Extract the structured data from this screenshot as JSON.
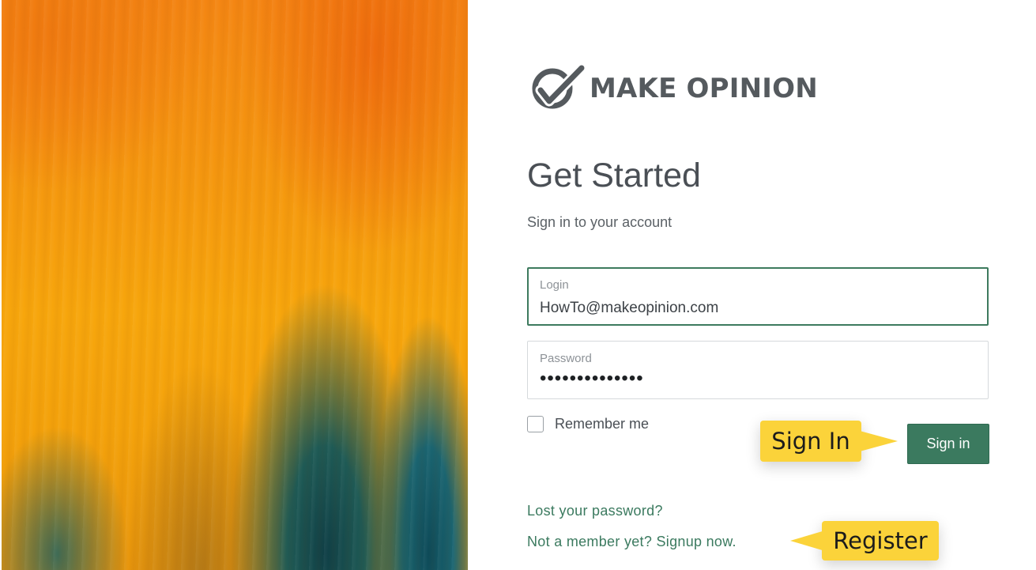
{
  "brand": {
    "name": "MAKE OPINION",
    "icon": "checkmark-circle-logo-icon",
    "color": "#555a5e"
  },
  "form": {
    "title": "Get Started",
    "subtitle": "Sign in to your account",
    "login": {
      "label": "Login",
      "value": "HowTo@makeopinion.com",
      "focused": true
    },
    "password": {
      "label": "Password",
      "value": "••••••••••••••"
    },
    "remember_label": "Remember me",
    "remember_checked": false,
    "submit_label": "Sign in",
    "lost_password_link": "Lost your password?",
    "signup_link": "Not a member yet? Signup now."
  },
  "callouts": {
    "sign_in": "Sign In",
    "register": "Register"
  },
  "colors": {
    "accent_green": "#3b7a5f",
    "callout_yellow": "#fbd33a",
    "art_orange": "#f5970f",
    "art_teal": "#1e5a55"
  }
}
